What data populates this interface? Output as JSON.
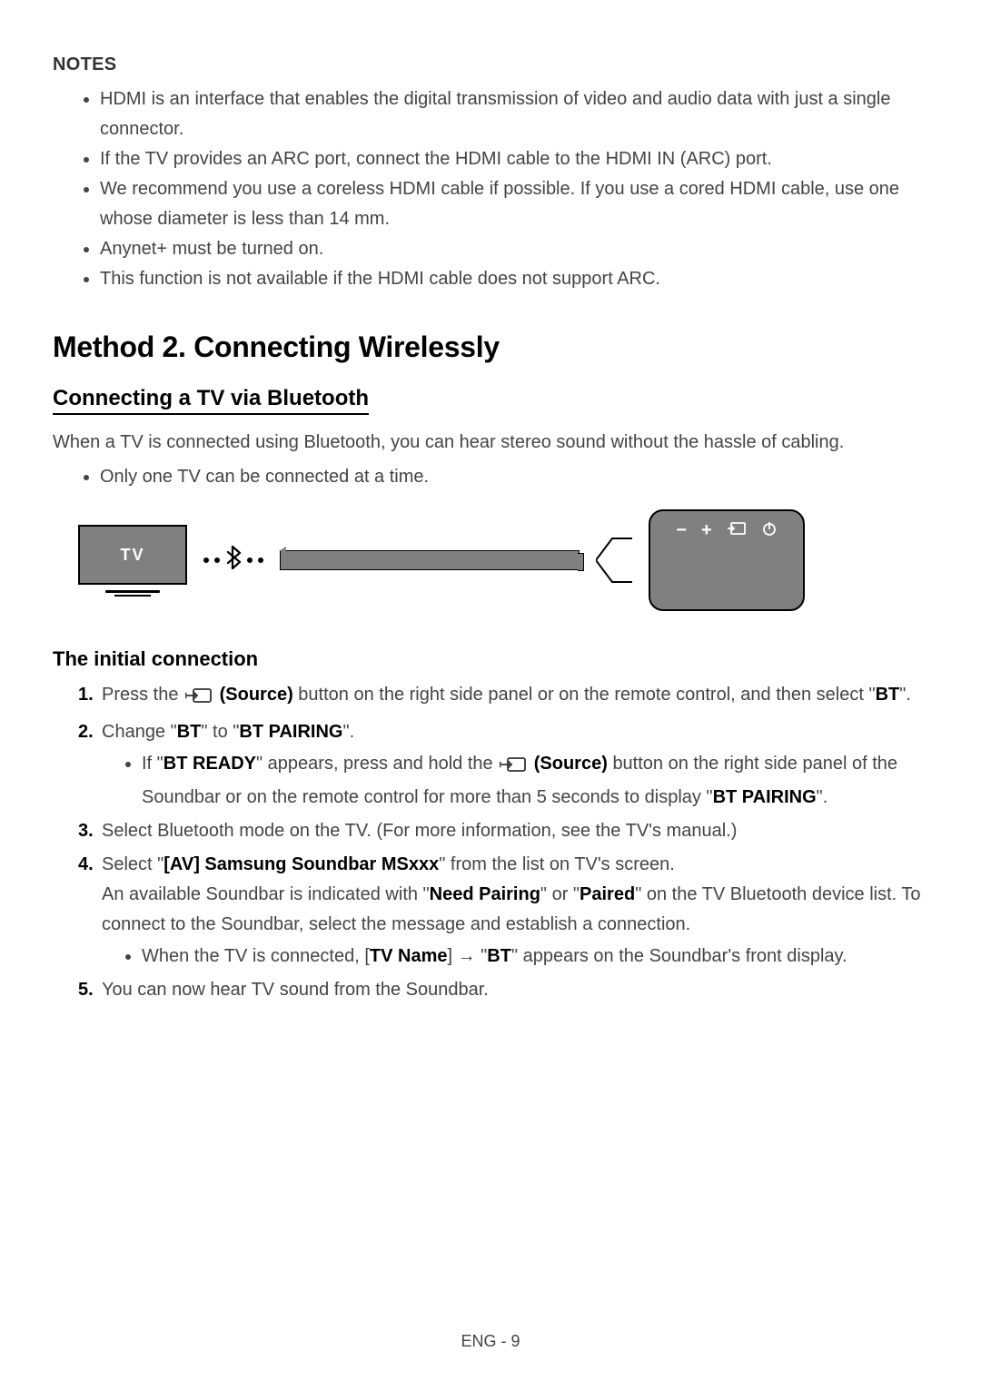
{
  "notes": {
    "heading": "NOTES",
    "items": [
      "HDMI is an interface that enables the digital transmission of video and audio data with just a single connector.",
      "If the TV provides an ARC port, connect the HDMI cable to the HDMI IN (ARC) port.",
      "We recommend you use a coreless HDMI cable if possible. If you use a cored HDMI cable, use one whose diameter is less than 14 mm.",
      "Anynet+ must be turned on.",
      "This function is not available if the HDMI cable does not support ARC."
    ]
  },
  "method_heading": "Method 2. Connecting Wirelessly",
  "sub_heading": "Connecting a TV via Bluetooth",
  "intro": "When a TV is connected using Bluetooth, you can hear stereo sound without the hassle of cabling.",
  "intro_bullet": "Only one TV can be connected at a time.",
  "diagram": {
    "tv_label": "TV",
    "panel_icons": [
      "−",
      "+",
      "source",
      "power"
    ]
  },
  "initial_heading": "The initial connection",
  "steps": {
    "s1a": "Press the ",
    "s1_source": " (Source)",
    "s1b": " button on the right side panel or on the remote control, and then select \"",
    "s1_bt": "BT",
    "s1c": "\".",
    "s2a": "Change \"",
    "s2_bt": "BT",
    "s2b": "\" to \"",
    "s2_pair": "BT PAIRING",
    "s2c": "\".",
    "s2_sub_a": "If \"",
    "s2_sub_ready": "BT READY",
    "s2_sub_b": "\" appears, press and hold the ",
    "s2_sub_source": " (Source)",
    "s2_sub_c": " button on the right side panel of the Soundbar or on the remote control for more than 5 seconds to display \"",
    "s2_sub_pair": "BT PAIRING",
    "s2_sub_d": "\".",
    "s3": "Select Bluetooth mode on the TV. (For more information, see the TV's manual.)",
    "s4a": "Select \"",
    "s4_dev": "[AV] Samsung Soundbar MSxxx",
    "s4b": "\" from the list on TV's screen.",
    "s4_line2a": "An available Soundbar is indicated with \"",
    "s4_need": "Need Pairing",
    "s4_line2b": "\" or \"",
    "s4_paired": "Paired",
    "s4_line2c": "\" on the TV Bluetooth device list. To connect to the Soundbar, select the message and establish a connection.",
    "s4_sub_a": "When the TV is connected, [",
    "s4_sub_tvname": "TV Name",
    "s4_sub_b": "] → \"",
    "s4_sub_bt": "BT",
    "s4_sub_c": "\" appears on the Soundbar's front display.",
    "s5": "You can now hear TV sound from the Soundbar."
  },
  "footer": "ENG - 9"
}
